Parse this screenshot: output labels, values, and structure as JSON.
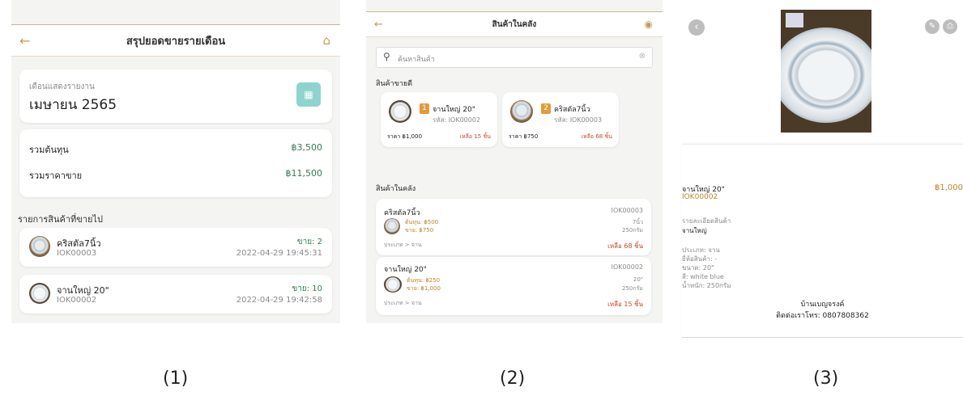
{
  "screen1": {
    "title": "สรุปยอดขายรายเดือน",
    "report_label": "เดือนแสดงรายงาน",
    "report_month": "เมษายน 2565",
    "cost_label": "รวมต้นทุน",
    "cost_value": "฿3,500",
    "sales_label": "รวมราคาขาย",
    "sales_value": "฿11,500",
    "section_title": "รายการสินค้าที่ขายไป",
    "items": [
      {
        "name": "คริสตัล7นิ้ว",
        "code": "IOK00003",
        "sold": "ขาย: 2",
        "datetime": "2022-04-29 19:45:31"
      },
      {
        "name": "จานใหญ่ 20\"",
        "code": "IOK00002",
        "sold": "ขาย: 10",
        "datetime": "2022-04-29 19:42:58"
      }
    ],
    "caption": "(1)"
  },
  "screen2": {
    "title": "สินค้าในคลัง",
    "search_placeholder": "ค้นหาสินค้า",
    "bestseller_title": "สินค้าขายดี",
    "bestsellers": [
      {
        "rank": "1",
        "name": "จานใหญ่ 20\"",
        "code": "รหัส: IOK00002",
        "price": "ราคา ฿1,000",
        "stock": "เหลือ 15 ชิ้น"
      },
      {
        "rank": "2",
        "name": "คริสตัล7นิ้ว",
        "code": "รหัส: IOK00003",
        "price": "ราคา ฿750",
        "stock": "เหลือ 68 ชิ้น"
      }
    ],
    "inventory_title": "สินค้าในคลัง",
    "inventory": [
      {
        "name": "คริสตัล7นิ้ว",
        "code": "IOK00003",
        "cost": "ต้นทุน: ฿500",
        "sale": "ขาย: ฿750",
        "size": "7นิ้ว",
        "weight": "250กรัม",
        "category": "ประเภท > จาน",
        "stock": "เหลือ 68 ชิ้น"
      },
      {
        "name": "จานใหญ่ 20\"",
        "code": "IOK00002",
        "cost": "ต้นทุน: ฿250",
        "sale": "ขาย: ฿1,000",
        "size": "20\"",
        "weight": "250กรัม",
        "category": "ประเภท > จาน",
        "stock": "เหลือ 15 ชิ้น"
      }
    ],
    "caption": "(2)"
  },
  "screen3": {
    "name": "จานใหญ่ 20\"",
    "code": "IOK00002",
    "price": "฿1,000",
    "detail_label": "รายละเอียดสินค้า",
    "detail_value": "จานใหญ่",
    "spec_type": "ประเภท: จาน",
    "spec_brand": "ยี่ห้อสินค้า: -",
    "spec_size": "ขนาด: 20\"",
    "spec_color": "สี: white blue",
    "spec_weight": "น้ำหนัก: 250กรัม",
    "shop_name": "บ้านเบญจรงค์",
    "contact": "ติดต่อเราโทร: 0807808362",
    "caption": "(3)"
  },
  "colors": {
    "accent": "#c49a54",
    "green": "#2e7d4f",
    "orange": "#e49a3b",
    "calendar_bg": "#8fd3cf"
  },
  "icons": [
    "back-arrow-icon",
    "home-icon",
    "calendar-icon",
    "search-icon",
    "clear-icon",
    "settings-icon",
    "close-icon",
    "edit-icon",
    "print-icon"
  ]
}
